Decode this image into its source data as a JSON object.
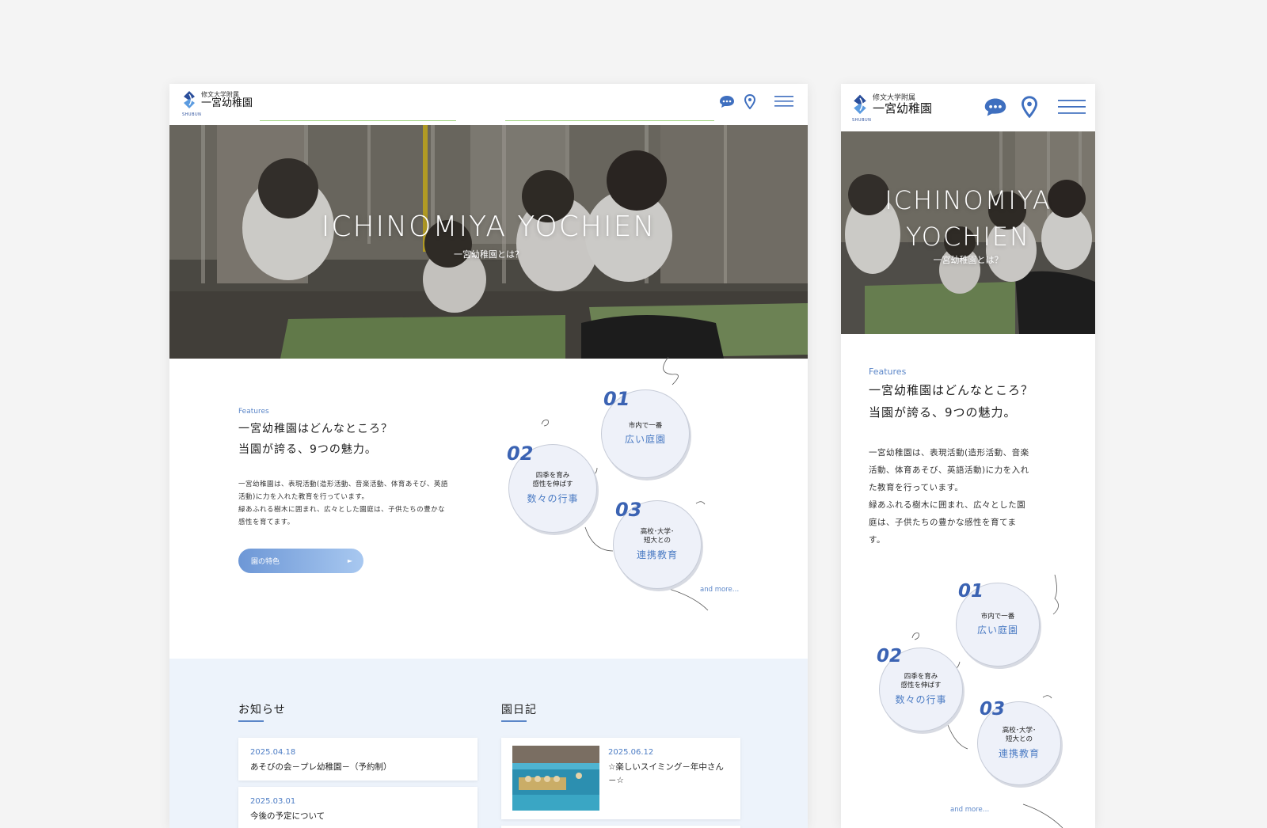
{
  "brand": {
    "sub": "修文大学附属",
    "main": "一宮幼稚園",
    "en": "SHUBUN"
  },
  "hero": {
    "title": "ICHINOMIYA YOCHIEN",
    "title_mobile_1": "ICHINOMIYA",
    "title_mobile_2": "YOCHIEN",
    "subtitle": "一宮幼稚園とは？"
  },
  "features": {
    "eyebrow": "Features",
    "heading_1": "一宮幼稚園はどんなところ？",
    "heading_2": "当園が誇る、9つの魅力。",
    "desktop_body": [
      "一宮幼稚園は、表現活動(造形活動、音楽活動、体育あそび、英語",
      "活動)に力を入れた教育を行っています。",
      "緑あふれる樹木に囲まれ、広々とした園庭は、子供たちの豊かな",
      "感性を育てます。"
    ],
    "mobile_body": [
      "一宮幼稚園は、表現活動(造形活動、音楽",
      "活動、体育あそび、英語活動)に力を入れ",
      "た教育を行っています。",
      "緑あふれる樹木に囲まれ、広々とした園",
      "庭は、子供たちの豊かな感性を育てま",
      "す。"
    ],
    "button_label": "園の特色",
    "button_arrow": "►",
    "items": [
      {
        "num": "01",
        "small_1": "市内で一番",
        "small_2": "",
        "large": "広い庭園"
      },
      {
        "num": "02",
        "small_1": "四季を育み",
        "small_2": "感性を伸ばす",
        "large": "数々の行事"
      },
      {
        "num": "03",
        "small_1": "高校･大学･",
        "small_2": "短大との",
        "large": "連携教育"
      }
    ],
    "more": "and more…"
  },
  "news": {
    "title": "お知らせ",
    "items": [
      {
        "date": "2025.04.18",
        "title": "あそびの会－プレ幼稚園－（予約制）"
      },
      {
        "date": "2025.03.01",
        "title": "今後の予定について"
      }
    ]
  },
  "diary": {
    "title": "園日記",
    "items": [
      {
        "date": "2025.06.12",
        "title_1": "☆楽しいスイミング－年中さん",
        "title_2": "－☆"
      }
    ]
  },
  "colors": {
    "accent": "#4c7cc4",
    "navy": "#2a4e9b",
    "light_bg": "#edf3fb",
    "page_bg": "#f4f4f4"
  },
  "icons": [
    "logo-mark-icon",
    "chat-bubble-icon",
    "map-pin-icon",
    "hamburger-menu-icon",
    "sprout-icon"
  ]
}
